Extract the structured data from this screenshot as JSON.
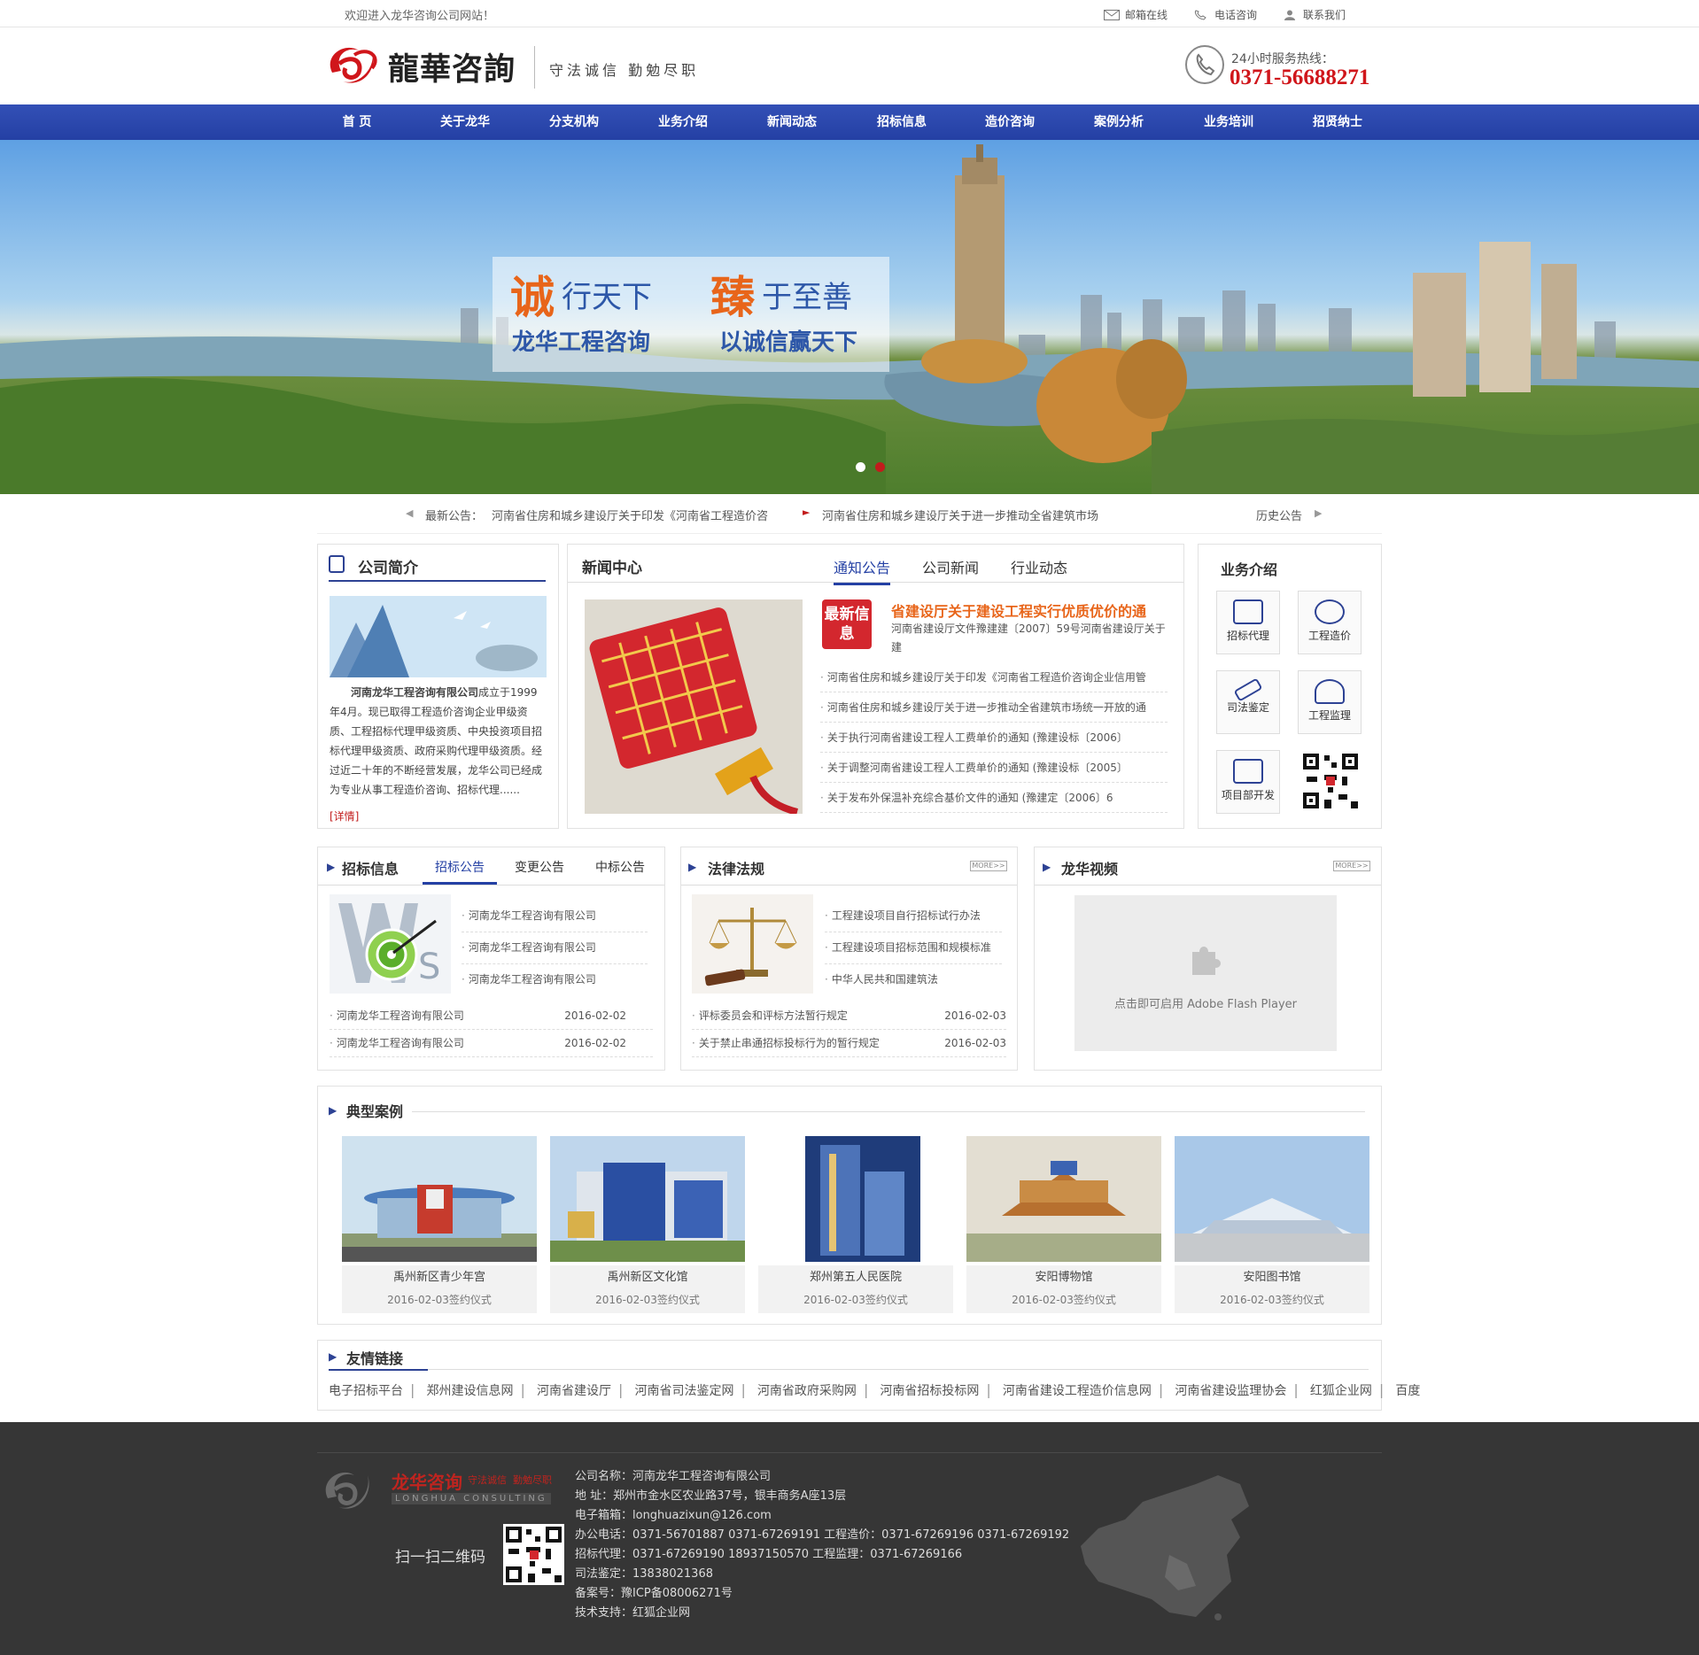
{
  "topbar": {
    "welcome": "欢迎进入龙华咨询公司网站！",
    "links": [
      {
        "icon": "mail-icon",
        "label": "邮箱在线"
      },
      {
        "icon": "phone-icon",
        "label": "电话咨询"
      },
      {
        "icon": "user-icon",
        "label": "联系我们"
      }
    ]
  },
  "header": {
    "logo_text": "龍華咨詢",
    "slogan": "守法诚信  勤勉尽职",
    "hotline_label": "24小时服务热线：",
    "hotline": "0371-56688271"
  },
  "nav": [
    "首 页",
    "关于龙华",
    "分支机构",
    "业务介绍",
    "新闻动态",
    "招标信息",
    "造价咨询",
    "案例分析",
    "业务培训",
    "招贤纳士"
  ],
  "banner": {
    "line1a": "诚",
    "line1b": "行天下",
    "line1c": "臻",
    "line1d": "于至善",
    "line2a": "龙华工程咨询",
    "line2b": "以诚信赢天下",
    "dots": 2
  },
  "notice": {
    "label": "最新公告：",
    "item1": "河南省住房和城乡建设厅关于印发《河南省工程造价咨",
    "item2": "河南省住房和城乡建设厅关于进一步推动全省建筑市场",
    "history": "历史公告"
  },
  "intro": {
    "title": "公司简介",
    "company": "河南龙华工程咨询有限公司",
    "text": "成立于1999年4月。现已取得工程造价咨询企业甲级资质、工程招标代理甲级资质、中央投资项目招标代理甲级资质、政府采购代理甲级资质。经过近二十年的不断经营发展，龙华公司已经成为专业从事工程造价咨询、招标代理......",
    "more": "[详情]"
  },
  "news": {
    "title": "新闻中心",
    "tabs": [
      "通知公告",
      "公司新闻",
      "行业动态"
    ],
    "badge": "最新信息",
    "headline": "省建设厅关于建设工程实行优质优价的通",
    "summary": "河南省建设厅文件豫建建〔2007〕59号河南省建设厅关于建",
    "items": [
      "河南省住房和城乡建设厅关于印发《河南省工程造价咨询企业信用管",
      "河南省住房和城乡建设厅关于进一步推动全省建筑市场统一开放的通",
      "关于执行河南省建设工程人工费单价的通知 (豫建设标〔2006〕",
      "关于调整河南省建设工程人工费单价的通知 (豫建设标〔2005〕",
      "关于发布外保温补充综合基价文件的通知 (豫建定〔2006〕6"
    ]
  },
  "services": {
    "title": "业务介绍",
    "items": [
      "招标代理",
      "工程造价",
      "司法鉴定",
      "工程监理",
      "项目部开发"
    ]
  },
  "bid": {
    "title": "招标信息",
    "tabs": [
      "招标公告",
      "变更公告",
      "中标公告"
    ],
    "top_items": [
      "河南龙华工程咨询有限公司",
      "河南龙华工程咨询有限公司",
      "河南龙华工程咨询有限公司"
    ],
    "rows": [
      {
        "name": "河南龙华工程咨询有限公司",
        "date": "2016-02-02"
      },
      {
        "name": "河南龙华工程咨询有限公司",
        "date": "2016-02-02"
      }
    ]
  },
  "law": {
    "title": "法律法规",
    "more": "MORE>>",
    "top_items": [
      "工程建设项目自行招标试行办法",
      "工程建设项目招标范围和规模标准",
      "中华人民共和国建筑法"
    ],
    "rows": [
      {
        "name": "评标委员会和评标方法暂行规定",
        "date": "2016-02-03"
      },
      {
        "name": "关于禁止串通招标投标行为的暂行规定",
        "date": "2016-02-03"
      }
    ]
  },
  "video": {
    "title": "龙华视频",
    "more": "MORE>>",
    "flash_text": "点击即可启用 Adobe Flash Player"
  },
  "cases": {
    "title": "典型案例",
    "items": [
      {
        "name": "禹州新区青少年宫",
        "date": "2016-02-03签约仪式"
      },
      {
        "name": "禹州新区文化馆",
        "date": "2016-02-03签约仪式"
      },
      {
        "name": "郑州第五人民医院",
        "date": "2016-02-03签约仪式"
      },
      {
        "name": "安阳博物馆",
        "date": "2016-02-03签约仪式"
      },
      {
        "name": "安阳图书馆",
        "date": "2016-02-03签约仪式"
      }
    ]
  },
  "links": {
    "title": "友情链接",
    "items": [
      "电子招标平台",
      "郑州建设信息网",
      "河南省建设厅",
      "河南省司法鉴定网",
      "河南省政府采购网",
      "河南省招标投标网",
      "河南省建设工程造价信息网",
      "河南省建设监理协会",
      "红狐企业网",
      "百度"
    ]
  },
  "footer": {
    "logo_text": "龙华咨询",
    "logo_slogan": "守法诚信  勤勉尽职",
    "logo_en": "LONGHUA CONSULTING",
    "qr_label": "扫一扫二维码",
    "lines": [
      "公司名称：河南龙华工程咨询有限公司",
      "地 址：郑州市金水区农业路37号，银丰商务A座13层",
      "电子箱箱：longhuazixun@126.com",
      "办公电话：0371-56701887 0371-67269191 工程造价：0371-67269196 0371-67269192",
      "招标代理：0371-67269190 18937150570   工程监理：0371-67269166",
      "司法鉴定：13838021368",
      "备案号：豫ICP备08006271号",
      "技术支持：红狐企业网"
    ]
  },
  "colors": {
    "nav": "#2440a4",
    "accent_red": "#d0161b",
    "headline_orange": "#e8651a",
    "footer_bg": "#363636"
  }
}
